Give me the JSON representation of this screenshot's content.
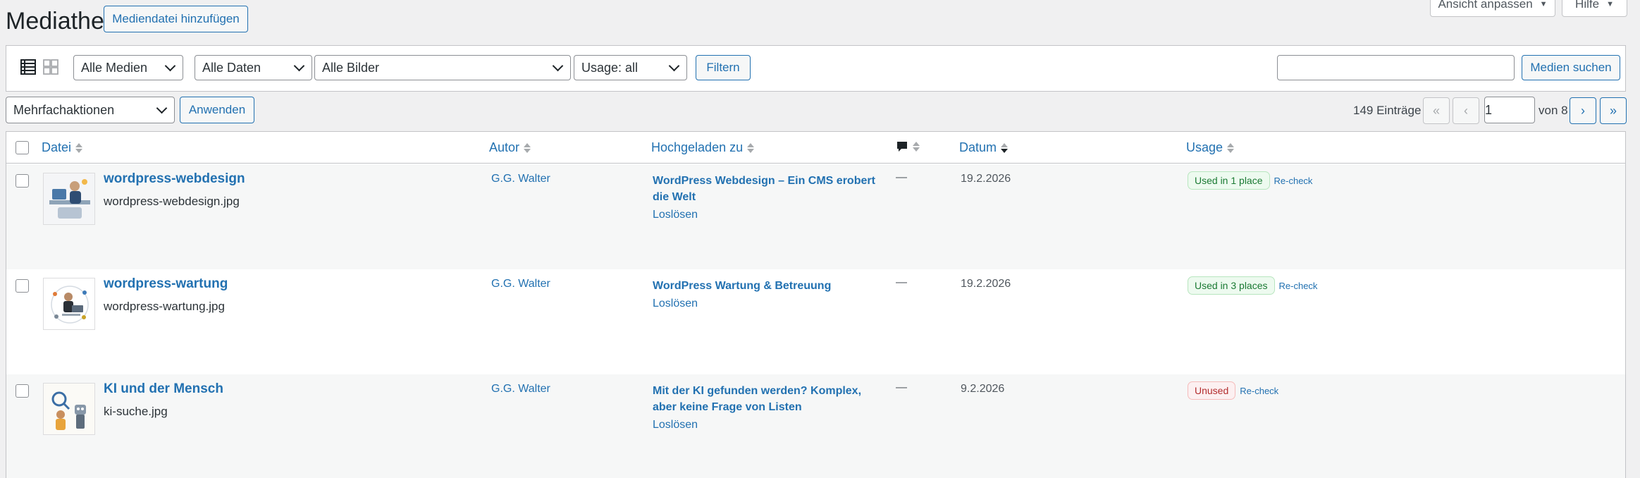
{
  "page": {
    "title": "Mediathek",
    "add_button": "Mediendatei hinzufügen",
    "screen_options": "Ansicht anpassen",
    "help": "Hilfe"
  },
  "filters": {
    "media_type": "Alle Medien",
    "dates": "Alle Daten",
    "images": "Alle Bilder",
    "usage": "Usage: all",
    "filter_button": "Filtern",
    "search_button": "Medien suchen",
    "search_value": ""
  },
  "bulk": {
    "action": "Mehrfachaktionen",
    "apply": "Anwenden"
  },
  "pagination": {
    "count": "149 Einträge",
    "first": "«",
    "prev": "‹",
    "current": "1",
    "of": "von 8",
    "next": "›",
    "last": "»"
  },
  "columns": {
    "file": "Datei",
    "author": "Autor",
    "uploaded_to": "Hochgeladen zu",
    "date": "Datum",
    "usage": "Usage"
  },
  "rows": [
    {
      "title": "wordpress-webdesign",
      "filename": "wordpress-webdesign.jpg",
      "author": "G.G. Walter",
      "parent": "WordPress Webdesign – Ein CMS erobert die Welt",
      "unlink": "Loslösen",
      "comments": "—",
      "date": "19.2.2026",
      "usage": "Used in 1 place",
      "recheck": "Re-check"
    },
    {
      "title": "wordpress-wartung",
      "filename": "wordpress-wartung.jpg",
      "author": "G.G. Walter",
      "parent": "WordPress Wartung & Betreuung",
      "unlink": "Loslösen",
      "comments": "—",
      "date": "19.2.2026",
      "usage": "Used in 3 places",
      "recheck": "Re-check"
    },
    {
      "title": "KI und der Mensch",
      "filename": "ki-suche.jpg",
      "author": "G.G. Walter",
      "parent": "Mit der KI gefunden werden? Komplex, aber keine Frage von Listen",
      "unlink": "Loslösen",
      "comments": "—",
      "date": "9.2.2026",
      "usage": "Unused",
      "recheck": "Re-check"
    }
  ],
  "colors": {
    "accent": "#2271b1",
    "used_badge_bg": "#edfaef",
    "unused_badge_bg": "#fcf0f1"
  }
}
